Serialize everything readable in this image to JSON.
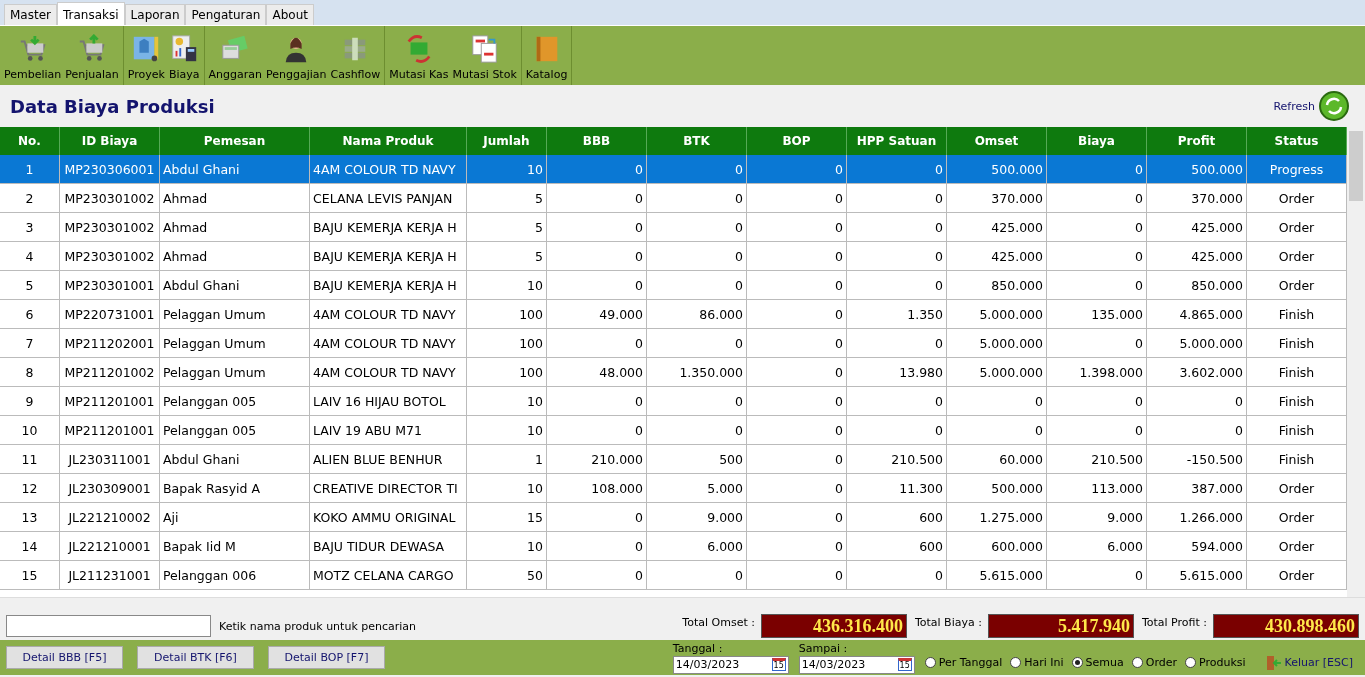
{
  "menu_tabs": [
    {
      "label": "Master",
      "selected": false
    },
    {
      "label": "Transaksi",
      "selected": true
    },
    {
      "label": "Laporan",
      "selected": false
    },
    {
      "label": "Pengaturan",
      "selected": false
    },
    {
      "label": "About",
      "selected": false
    }
  ],
  "toolbar_groups": [
    [
      "Pembelian",
      "Penjualan"
    ],
    [
      "Proyek",
      "Biaya"
    ],
    [
      "Anggaran",
      "Penggajian",
      "Cashflow"
    ],
    [
      "Mutasi Kas",
      "Mutasi Stok"
    ],
    [
      "Katalog"
    ]
  ],
  "title": "Data Biaya Produksi",
  "refresh": "Refresh",
  "table": {
    "columns": [
      "No.",
      "ID Biaya",
      "Pemesan",
      "Nama Produk",
      "Jumlah",
      "BBB",
      "BTK",
      "BOP",
      "HPP Satuan",
      "Omset",
      "Biaya",
      "Profit",
      "Status"
    ],
    "rows": [
      {
        "selected": true,
        "cells": [
          "1",
          "MP230306001",
          "Abdul Ghani",
          "4AM COLOUR TD NAVY",
          "10",
          "0",
          "0",
          "0",
          "0",
          "500.000",
          "0",
          "500.000",
          "Progress"
        ]
      },
      {
        "selected": false,
        "cells": [
          "2",
          "MP230301002",
          "Ahmad",
          "CELANA LEVIS PANJAN",
          "5",
          "0",
          "0",
          "0",
          "0",
          "370.000",
          "0",
          "370.000",
          "Order"
        ]
      },
      {
        "selected": false,
        "cells": [
          "3",
          "MP230301002",
          "Ahmad",
          "BAJU KEMERJA KERJA H",
          "5",
          "0",
          "0",
          "0",
          "0",
          "425.000",
          "0",
          "425.000",
          "Order"
        ]
      },
      {
        "selected": false,
        "cells": [
          "4",
          "MP230301002",
          "Ahmad",
          "BAJU KEMERJA KERJA H",
          "5",
          "0",
          "0",
          "0",
          "0",
          "425.000",
          "0",
          "425.000",
          "Order"
        ]
      },
      {
        "selected": false,
        "cells": [
          "5",
          "MP230301001",
          "Abdul Ghani",
          "BAJU KEMERJA KERJA H",
          "10",
          "0",
          "0",
          "0",
          "0",
          "850.000",
          "0",
          "850.000",
          "Order"
        ]
      },
      {
        "selected": false,
        "cells": [
          "6",
          "MP220731001",
          "Pelaggan Umum",
          "4AM COLOUR TD NAVY",
          "100",
          "49.000",
          "86.000",
          "0",
          "1.350",
          "5.000.000",
          "135.000",
          "4.865.000",
          "Finish"
        ]
      },
      {
        "selected": false,
        "cells": [
          "7",
          "MP211202001",
          "Pelaggan Umum",
          "4AM COLOUR TD NAVY",
          "100",
          "0",
          "0",
          "0",
          "0",
          "5.000.000",
          "0",
          "5.000.000",
          "Finish"
        ]
      },
      {
        "selected": false,
        "cells": [
          "8",
          "MP211201002",
          "Pelaggan Umum",
          "4AM COLOUR TD NAVY",
          "100",
          "48.000",
          "1.350.000",
          "0",
          "13.980",
          "5.000.000",
          "1.398.000",
          "3.602.000",
          "Finish"
        ]
      },
      {
        "selected": false,
        "cells": [
          "9",
          "MP211201001",
          "Pelanggan 005",
          "LAIV 16 HIJAU BOTOL",
          "10",
          "0",
          "0",
          "0",
          "0",
          "0",
          "0",
          "0",
          "Finish"
        ]
      },
      {
        "selected": false,
        "cells": [
          "10",
          "MP211201001",
          "Pelanggan 005",
          "LAIV 19 ABU M71",
          "10",
          "0",
          "0",
          "0",
          "0",
          "0",
          "0",
          "0",
          "Finish"
        ]
      },
      {
        "selected": false,
        "cells": [
          "11",
          "JL230311001",
          "Abdul Ghani",
          "ALIEN BLUE BENHUR",
          "1",
          "210.000",
          "500",
          "0",
          "210.500",
          "60.000",
          "210.500",
          "-150.500",
          "Finish"
        ]
      },
      {
        "selected": false,
        "cells": [
          "12",
          "JL230309001",
          "Bapak Rasyid A",
          "CREATIVE DIRECTOR TI",
          "10",
          "108.000",
          "5.000",
          "0",
          "11.300",
          "500.000",
          "113.000",
          "387.000",
          "Order"
        ]
      },
      {
        "selected": false,
        "cells": [
          "13",
          "JL221210002",
          "Aji",
          "KOKO AMMU ORIGINAL",
          "15",
          "0",
          "9.000",
          "0",
          "600",
          "1.275.000",
          "9.000",
          "1.266.000",
          "Order"
        ]
      },
      {
        "selected": false,
        "cells": [
          "14",
          "JL221210001",
          "Bapak Iid M",
          "BAJU TIDUR DEWASA",
          "10",
          "0",
          "6.000",
          "0",
          "600",
          "600.000",
          "6.000",
          "594.000",
          "Order"
        ]
      },
      {
        "selected": false,
        "cells": [
          "15",
          "JL211231001",
          "Pelanggan 006",
          "MOTZ CELANA CARGO",
          "50",
          "0",
          "0",
          "0",
          "0",
          "5.615.000",
          "0",
          "5.615.000",
          "Order"
        ]
      }
    ]
  },
  "search": {
    "hint": "Ketik nama produk untuk pencarian"
  },
  "totals": [
    {
      "label": "Total Omset :",
      "value": "436.316.400"
    },
    {
      "label": "Total Biaya :",
      "value": "5.417.940"
    },
    {
      "label": "Total Profit :",
      "value": "430.898.460"
    }
  ],
  "buttons": [
    "Detail BBB [F5]",
    "Detail BTK [F6]",
    "Detail BOP [F7]"
  ],
  "dates": [
    {
      "label": "Tanggal :",
      "value": "14/03/2023",
      "icon_text": "15"
    },
    {
      "label": "Sampai :",
      "value": "14/03/2023",
      "icon_text": "15"
    }
  ],
  "filters": [
    {
      "label": "Per Tanggal",
      "selected": false
    },
    {
      "label": "Hari Ini",
      "selected": false
    },
    {
      "label": "Semua",
      "selected": true
    },
    {
      "label": "Order",
      "selected": false
    },
    {
      "label": "Produksi",
      "selected": false
    }
  ],
  "exit": "Keluar [ESC]"
}
